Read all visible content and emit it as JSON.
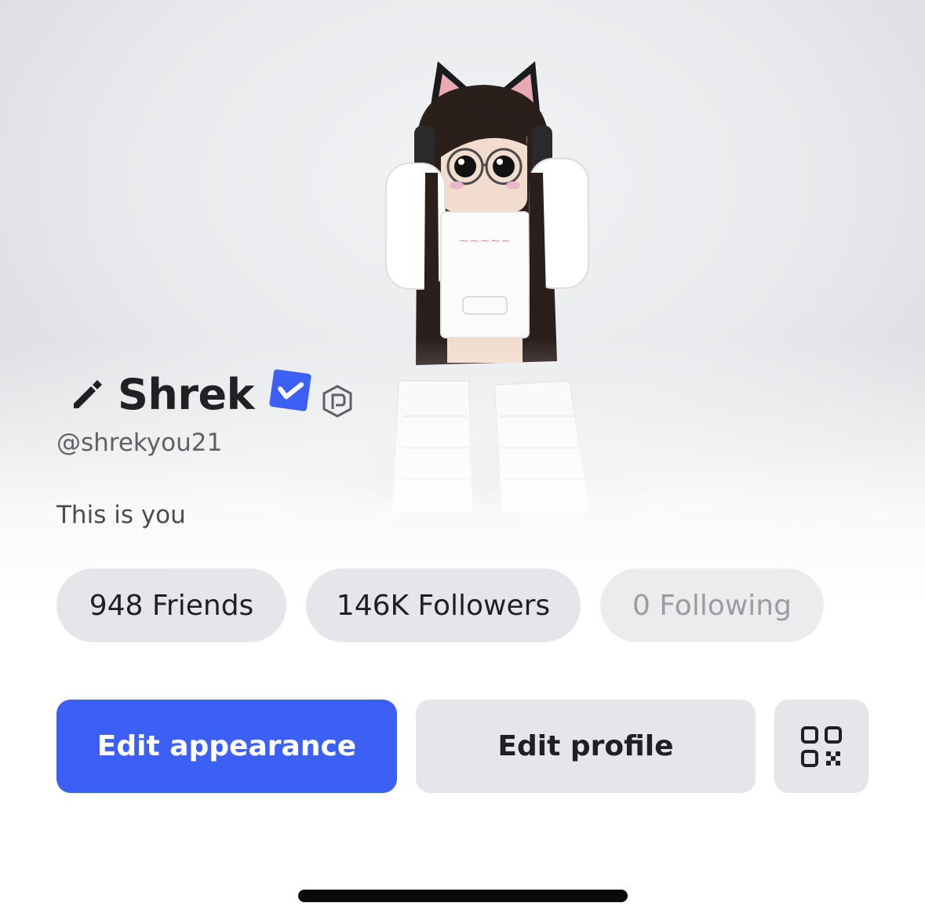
{
  "profile": {
    "display_name": "Shrek",
    "username": "@shrekyou21",
    "bio": "This is you",
    "icons": {
      "edit": "pencil-icon",
      "verified": "verified-badge-icon",
      "premium": "premium-icon"
    }
  },
  "stats": {
    "friends": "948 Friends",
    "followers": "146K Followers",
    "following": "0 Following"
  },
  "actions": {
    "edit_appearance": "Edit appearance",
    "edit_profile": "Edit profile",
    "qr_icon": "qr-code-icon"
  },
  "colors": {
    "primary": "#3c5ff5",
    "verified": "#3c5ff5",
    "chip_bg": "#e5e6ea",
    "text": "#1f2024"
  }
}
